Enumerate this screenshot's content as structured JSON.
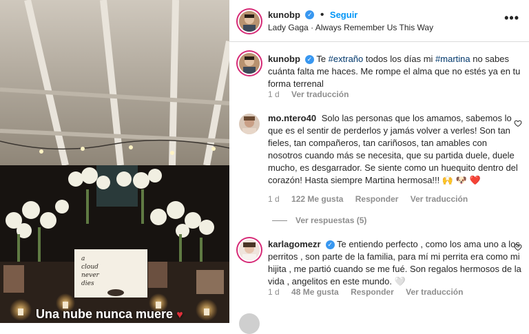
{
  "story": {
    "caption": "Una nube nunca muere",
    "caption_emoji": "♥",
    "sign_text": [
      "a",
      "cloud",
      "never",
      "dies"
    ]
  },
  "header": {
    "username": "kunobp",
    "follow_label": "Seguir",
    "separator": "•",
    "music_artist": "Lady Gaga",
    "music_track": "Always Remember Us This Way",
    "more_label": "•••"
  },
  "post_caption": {
    "username": "kunobp",
    "text_parts": [
      "Te ",
      "#extraño",
      " todos los días mi ",
      "#martina",
      " no sabes cuánta falta me haces. Me rompe el alma que no estés ya en tu forma terrenal"
    ],
    "time": "1 d",
    "translate": "Ver traducción"
  },
  "comments": [
    {
      "username": "mo.ntero40",
      "text": "Solo las personas que los amamos, sabemos lo que es el sentir de perderlos y jamás volver a verles! Son tan fieles, tan compañeros, tan cariñosos, tan amables con nosotros cuando más se necesita, que su partida duele, duele mucho, es desgarrador. Se siente como un huequito dentro del corazón! Hasta siempre Martina hermosa!!! 🙌 🐶 ❤️",
      "time": "1 d",
      "likes": "122 Me gusta",
      "reply": "Responder",
      "translate": "Ver traducción",
      "view_replies": "Ver respuestas (5)"
    },
    {
      "username": "karlagomezr",
      "text": "Te entiendo perfecto , como los ama uno a los perritos , son parte de la familia, para mí mi perrita era como mi hijita , me partió cuando se me fué. Son regalos hermosos de la vida , angelitos en este mundo. 🤍",
      "time": "1 d",
      "likes": "48 Me gusta",
      "reply": "Responder",
      "translate": "Ver traducción"
    }
  ],
  "colors": {
    "accent": "#0095f6",
    "verified": "#3897f0",
    "hashtag": "#00376b",
    "muted": "#8e8e8e"
  }
}
